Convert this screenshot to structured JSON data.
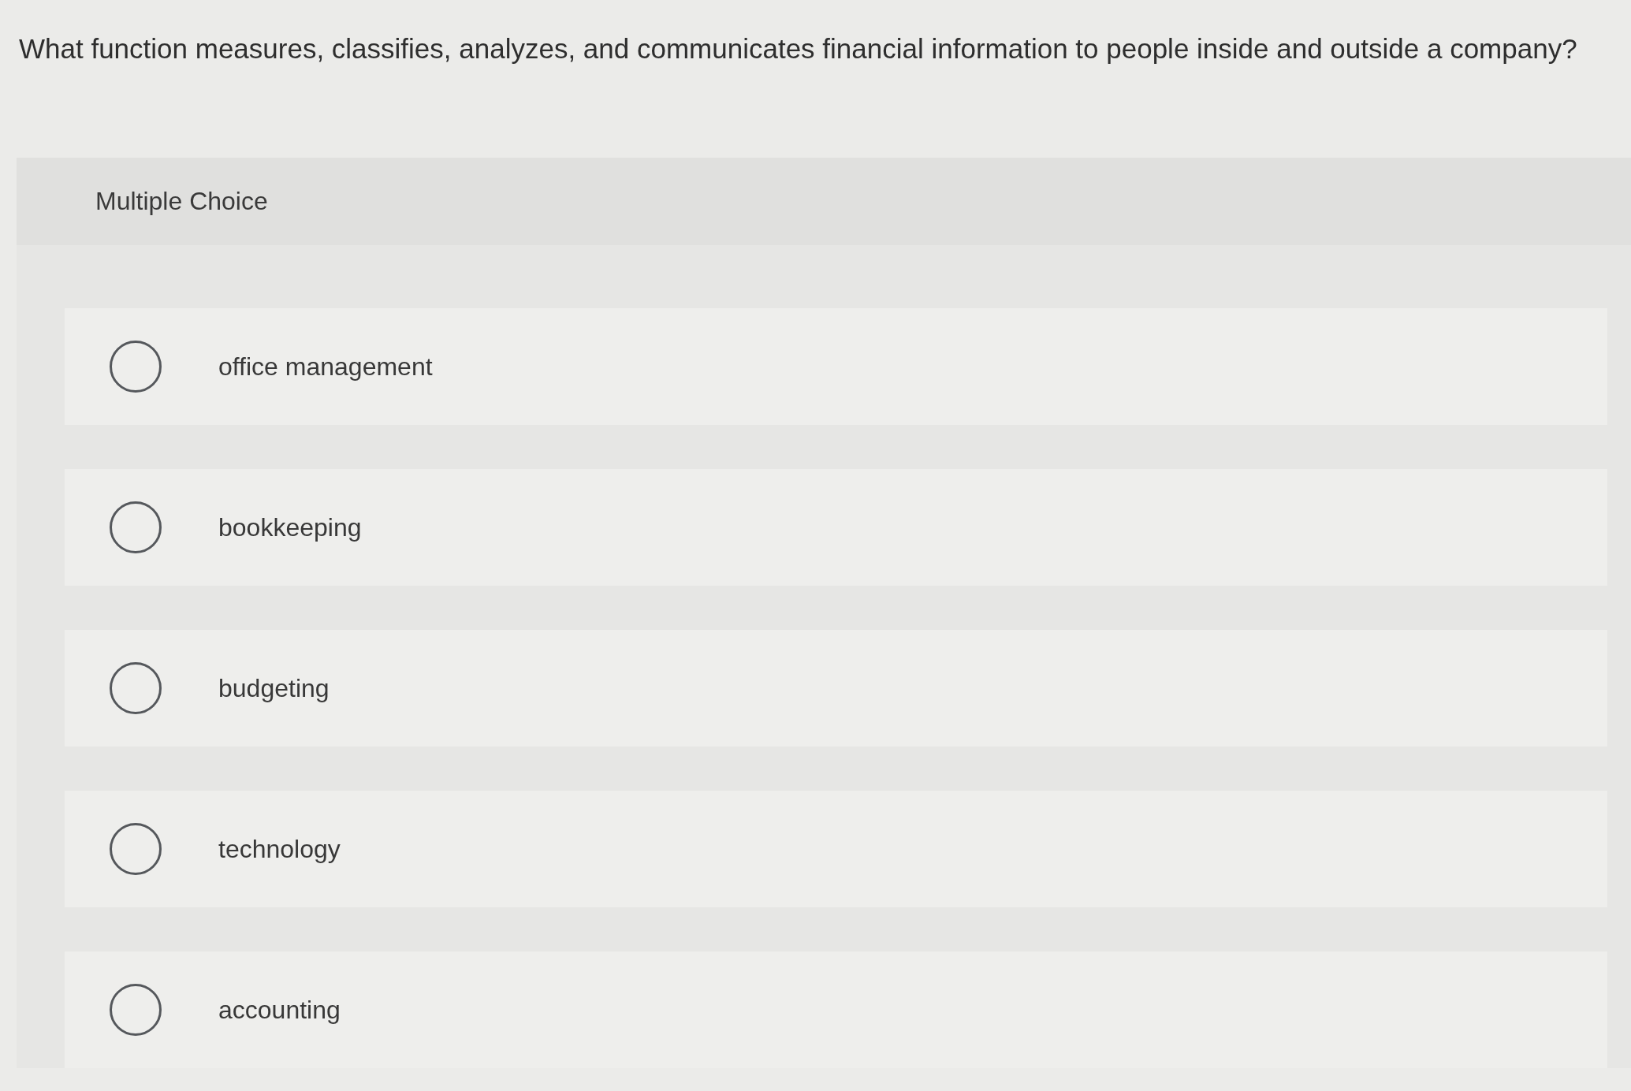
{
  "question": "What function measures, classifies, analyzes, and communicates financial information to people inside and outside a company?",
  "section": {
    "title": "Multiple Choice"
  },
  "options": [
    {
      "label": "office management",
      "selected": false
    },
    {
      "label": "bookkeeping",
      "selected": false
    },
    {
      "label": "budgeting",
      "selected": false
    },
    {
      "label": "technology",
      "selected": false
    },
    {
      "label": "accounting",
      "selected": false
    }
  ]
}
